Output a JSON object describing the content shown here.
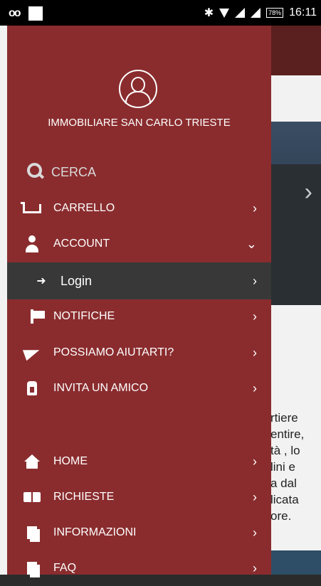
{
  "status_bar": {
    "time": "16:11",
    "battery": "78%"
  },
  "drawer": {
    "shop_name": "IMMOBILIARE SAN CARLO TRIESTE",
    "search_label": "CERCA",
    "items": [
      {
        "label": "CARRELLO",
        "icon": "cart-icon",
        "chevron": "›"
      },
      {
        "label": "ACCOUNT",
        "icon": "user-icon",
        "chevron": "⌄"
      },
      {
        "label": "Login",
        "icon": "login-icon",
        "chevron": "›"
      },
      {
        "label": "NOTIFICHE",
        "icon": "flag-icon",
        "chevron": "›"
      },
      {
        "label": "POSSIAMO AIUTARTI?",
        "icon": "paper-plane-icon",
        "chevron": "›"
      },
      {
        "label": "INVITA UN AMICO",
        "icon": "invite-user-icon",
        "chevron": "›"
      },
      {
        "label": "HOME",
        "icon": "home-icon",
        "chevron": "›"
      },
      {
        "label": "RICHIESTE",
        "icon": "book-icon",
        "chevron": "›"
      },
      {
        "label": "INFORMAZIONI",
        "icon": "documents-icon",
        "chevron": "›"
      },
      {
        "label": "FAQ",
        "icon": "faq-icon",
        "chevron": "›"
      }
    ]
  },
  "background": {
    "text_lines": [
      "rtiere",
      "entire,",
      "tà , lo",
      "lini e",
      "a dal",
      "licata",
      "ore."
    ]
  },
  "colors": {
    "drawer_bg": "#8a2c2e",
    "active_bg": "#383838"
  }
}
